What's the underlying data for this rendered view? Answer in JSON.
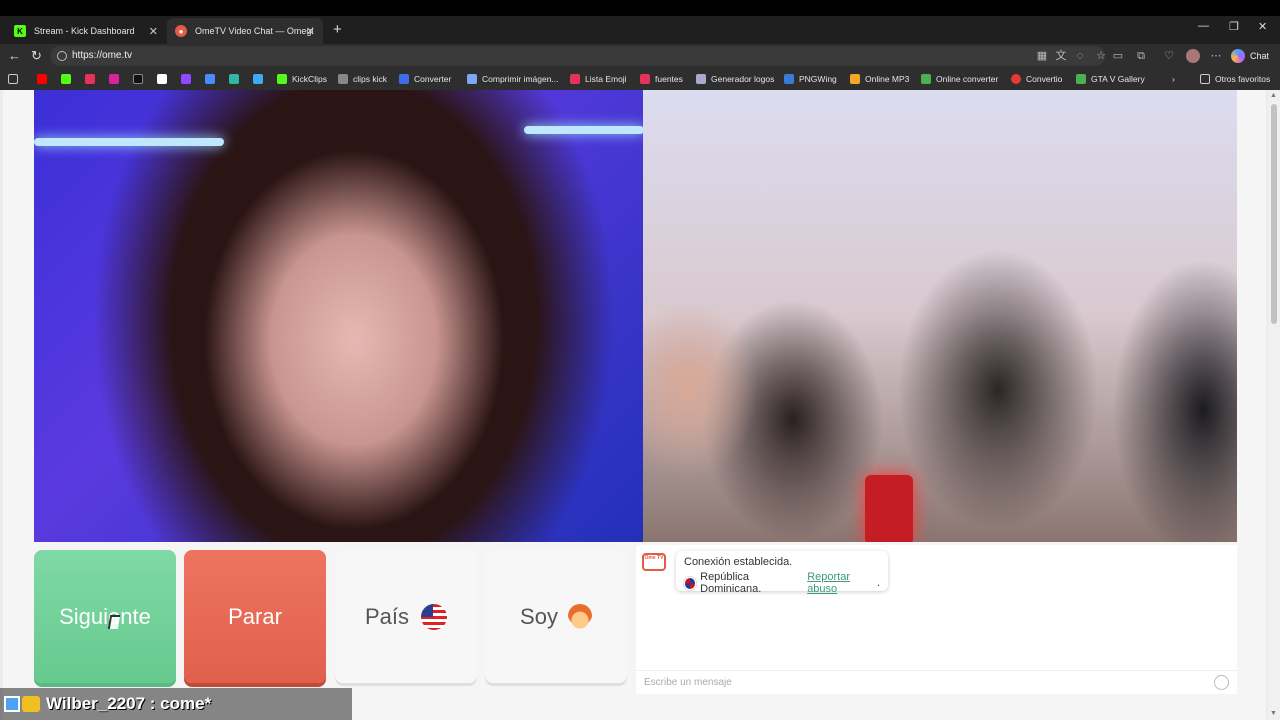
{
  "browser": {
    "tabs": [
      {
        "label": "Stream - Kick Dashboard",
        "icon": "kick-icon"
      },
      {
        "label": "OmeTV Video Chat — Omegl",
        "icon": "ometv-icon",
        "active": true
      }
    ],
    "new_tab": "+",
    "window_controls": {
      "minimize": "—",
      "restore": "❐",
      "close": "✕"
    },
    "url": "https://ome.tv",
    "chat_button": "Chat",
    "bookmarks": [
      "KickClips",
      "clips kick",
      "Converter",
      "Comprimir imágen...",
      "Lista Emoji",
      "fuentes",
      "Generador logos",
      "PNGWing",
      "Online MP3",
      "Online converter",
      "Convertio",
      "GTA V Gallery"
    ],
    "other_bookmarks": "Otros favoritos"
  },
  "controls": {
    "next": "Siguiente",
    "stop": "Parar",
    "country": "País",
    "me": "Soy"
  },
  "chat": {
    "logo_text": "Ome TV",
    "status": "Conexión establecida.",
    "country": "República Dominicana.",
    "report": "Reportar abuso",
    "report_suffix": ".",
    "placeholder": "Escribe un mensaje"
  },
  "overlay": {
    "message": "Wilber_2207 : come*"
  },
  "colors": {
    "next": "#6fd19a",
    "stop": "#e8674f",
    "accent_link": "#3b9a7f"
  }
}
